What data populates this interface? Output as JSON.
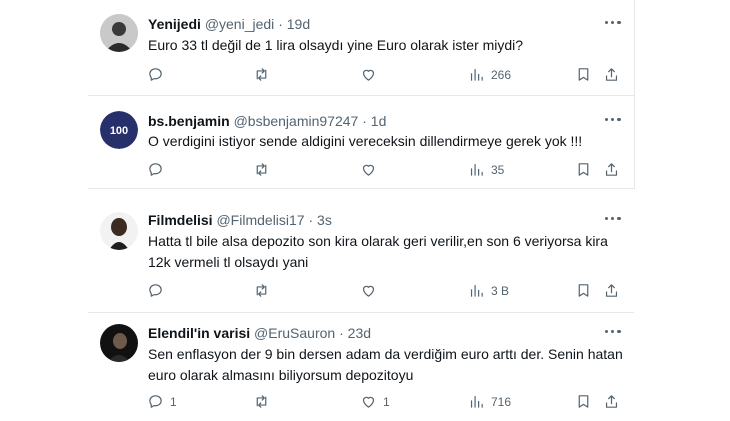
{
  "tweets": [
    {
      "name": "Yenijedi",
      "handle": "@yeni_jedi",
      "time": "19d",
      "text": "Euro 33 tl değil de 1 lira olsaydı yine Euro olarak ister miydi?",
      "replies": "",
      "likes": "",
      "views": "266",
      "avatar": "person-photo"
    },
    {
      "name": "bs.benjamin",
      "handle": "@bsbenjamin97247",
      "time": "1d",
      "text": "O verdigini istiyor sende aldigini vereceksin dillendirmeye gerek yok !!!",
      "replies": "",
      "likes": "",
      "views": "35",
      "avatar_text": "100",
      "avatar": "100-logo",
      "avatar_color": "#27306b"
    },
    {
      "name": "Filmdelisi",
      "handle": "@Filmdelisi17",
      "time": "3s",
      "text": "Hatta tl bile alsa depozito son kira olarak geri verilir,en son 6 veriyorsa kira 12k vermeli tl olsaydı yani",
      "replies": "",
      "likes": "",
      "views": "3 B",
      "avatar": "person-photo"
    },
    {
      "name": "Elendil'in varisi",
      "handle": "@EruSauron",
      "time": "23d",
      "text": "Sen enflasyon der 9 bin dersen adam da verdiğim euro arttı der. Senin hatan euro olarak almasını biliyorsum depozitoyu",
      "replies": "1",
      "likes": "1",
      "views": "716",
      "avatar": "person-photo"
    }
  ],
  "icons": [
    "reply-icon",
    "retweet-icon",
    "like-icon",
    "views-icon",
    "bookmark-icon",
    "share-icon",
    "more-icon"
  ],
  "colors": {
    "text": "#0f1419",
    "secondary": "#536471",
    "border": "#e6e9ec"
  }
}
